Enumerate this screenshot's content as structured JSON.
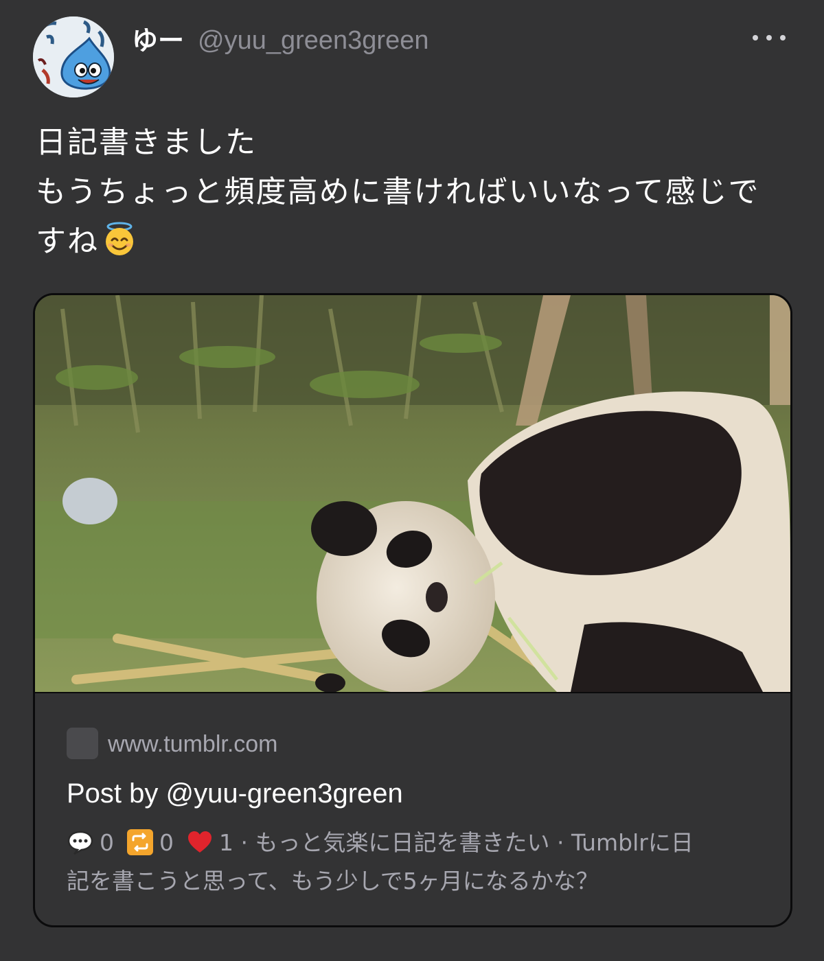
{
  "user": {
    "display_name": "ゆー",
    "handle": "@yuu_green3green",
    "avatar_icon": "slime-avatar-icon"
  },
  "post": {
    "text_lines": [
      "日記書きました",
      "もうちょっと頻度高めに書ければいいなって感じで",
      "すね"
    ],
    "emoji": "smiling-face-with-halo-icon"
  },
  "card": {
    "image_icon": "panda-photo",
    "domain": "www.tumblr.com",
    "title": "Post by @yuu-green3green",
    "stats": {
      "replies": "0",
      "reblogs": "0",
      "likes": "1"
    },
    "description_part1": " · もっと気楽に日記を書きたい · Tumblrに日",
    "description_part2": "記を書こうと思って、もう少しで5ヶ月になるかな？"
  },
  "colors": {
    "background": "#333334",
    "handle": "#8e8e96",
    "muted_text": "#a7a7b0",
    "card_border": "#0b0b0c"
  }
}
